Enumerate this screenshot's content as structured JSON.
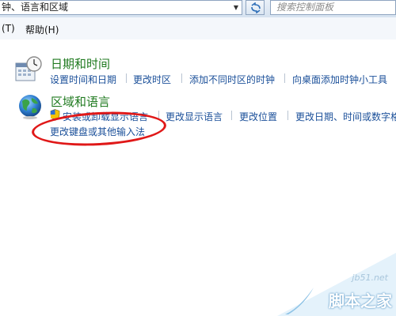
{
  "address": {
    "breadcrumb": "钟、语言和区域",
    "dropdown_icon": "chevron-down-icon",
    "refresh_icon": "refresh-icon"
  },
  "search": {
    "placeholder": "搜索控制面板"
  },
  "menu": {
    "items": [
      {
        "label": "(T)"
      },
      {
        "label": "帮助(H)"
      }
    ]
  },
  "categories": [
    {
      "title": "日期和时间",
      "icon": "calendar-clock-icon",
      "links": [
        "设置时间和日期",
        "更改时区",
        "添加不同时区的时钟",
        "向桌面添加时钟小工具"
      ]
    },
    {
      "title": "区域和语言",
      "icon": "globe-icon",
      "links": [
        "安装或卸载显示语言",
        "更改显示语言",
        "更改位置",
        "更改日期、时间或数字格式",
        "更改键盘或其他输入法"
      ]
    }
  ],
  "annotation": {
    "color": "#e01818"
  },
  "watermark": {
    "url": "jb51.net",
    "brand": "脚本之家"
  },
  "colors": {
    "link": "#1a4f99",
    "category_title": "#1f7a1f"
  }
}
